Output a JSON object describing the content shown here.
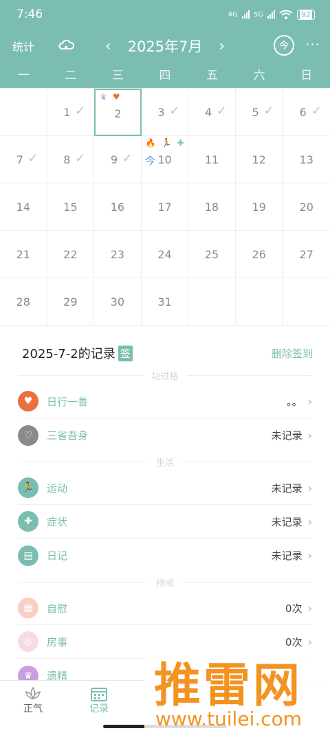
{
  "status": {
    "time": "7:46",
    "net1": "4G",
    "net2": "5G",
    "battery": "92"
  },
  "nav": {
    "stats_label": "统计",
    "prev": "‹",
    "month": "2025年7月",
    "next": "›",
    "today_label": "今",
    "more": "···"
  },
  "weekdays": [
    "一",
    "二",
    "三",
    "四",
    "五",
    "六",
    "日"
  ],
  "calendar": {
    "check_mark": "✓",
    "today_label": "今",
    "days": [
      {
        "d": ""
      },
      {
        "d": "1",
        "check": true
      },
      {
        "d": "2",
        "selected": true,
        "marks": [
          "pink-mark",
          "heart"
        ]
      },
      {
        "d": "3",
        "check": true
      },
      {
        "d": "4",
        "check": true
      },
      {
        "d": "5",
        "check": true
      },
      {
        "d": "6",
        "check": true
      },
      {
        "d": "7",
        "check": true
      },
      {
        "d": "8",
        "check": true
      },
      {
        "d": "9",
        "check": true
      },
      {
        "d": "10",
        "today": true,
        "marks": [
          "fire",
          "run",
          "kit"
        ]
      },
      {
        "d": "11"
      },
      {
        "d": "12"
      },
      {
        "d": "13"
      },
      {
        "d": "14"
      },
      {
        "d": "15"
      },
      {
        "d": "16"
      },
      {
        "d": "17"
      },
      {
        "d": "18"
      },
      {
        "d": "19"
      },
      {
        "d": "20"
      },
      {
        "d": "21"
      },
      {
        "d": "22"
      },
      {
        "d": "23"
      },
      {
        "d": "24"
      },
      {
        "d": "25"
      },
      {
        "d": "26"
      },
      {
        "d": "27"
      },
      {
        "d": "28"
      },
      {
        "d": "29"
      },
      {
        "d": "30"
      },
      {
        "d": "31"
      },
      {
        "d": ""
      },
      {
        "d": ""
      },
      {
        "d": ""
      }
    ]
  },
  "record": {
    "title": "2025-7-2的记录",
    "sign_badge": "签",
    "delete_label": "删除签到",
    "sections": [
      {
        "title": "功过格",
        "items": [
          {
            "icon": "heart-icon",
            "label": "日行一善",
            "value": "。。",
            "color": "#e9713f"
          },
          {
            "icon": "heart-outline-icon",
            "label": "三省吾身",
            "value": "未记录",
            "color": "#8a8a8a"
          }
        ]
      },
      {
        "title": "生活",
        "items": [
          {
            "icon": "running-icon",
            "label": "运动",
            "value": "未记录",
            "color": "#7cbdb1"
          },
          {
            "icon": "medical-kit-icon",
            "label": "症状",
            "value": "未记录",
            "color": "#7cbdb1"
          },
          {
            "icon": "diary-icon",
            "label": "日记",
            "value": "未记录",
            "color": "#7cbdb1"
          }
        ]
      },
      {
        "title": "持戒",
        "items": [
          {
            "icon": "self-icon",
            "label": "自慰",
            "value": "0次",
            "color": "#f7cfc3"
          },
          {
            "icon": "room-icon",
            "label": "房事",
            "value": "0次",
            "color": "#f6dbe6"
          },
          {
            "icon": "nocturnal-icon",
            "label": "遗精",
            "value": "",
            "color": "#c99de0"
          }
        ]
      }
    ]
  },
  "tabs": [
    {
      "label": "正气",
      "icon": "lotus-icon"
    },
    {
      "label": "记录",
      "icon": "calendar-icon"
    }
  ],
  "watermark": {
    "big": "推雷网",
    "small": "www.tuilei.com"
  },
  "colors": {
    "primary": "#7cbdb1",
    "header_bg": "#7cbdb1",
    "check": "#9ed3c6"
  }
}
